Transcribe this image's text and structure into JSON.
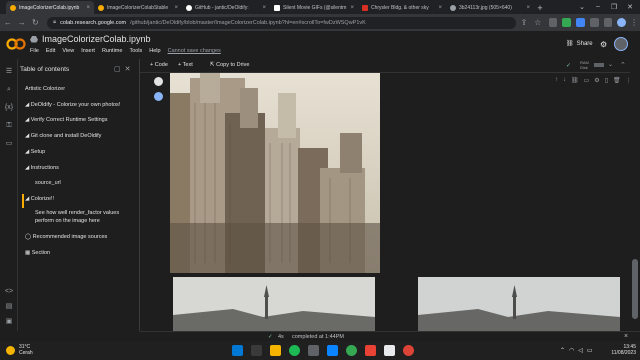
{
  "browser": {
    "tabs": [
      {
        "label": "ImageColorizerColab.ipynb",
        "favicon": "colab-icon",
        "color": "#f9ab00",
        "active": true
      },
      {
        "label": "ImageColorizerColabStable",
        "favicon": "colab-icon",
        "color": "#f9ab00",
        "active": false
      },
      {
        "label": "GitHub - jantic/DeOldify:",
        "favicon": "github-icon",
        "color": "#ffffff",
        "active": false
      },
      {
        "label": "Silent Movie GIFs (@silentm",
        "favicon": "x-icon",
        "color": "#ffffff",
        "active": false
      },
      {
        "label": "Chrysler Bldg. & other sky",
        "favicon": "page-icon",
        "color": "#d93025",
        "active": false
      },
      {
        "label": "3b24113r.jpg (505×640)",
        "favicon": "globe-icon",
        "color": "#9aa0a6",
        "active": false
      }
    ],
    "tab_close": "×",
    "new_tab": "+",
    "url_host": "colab.research.google.com",
    "url_path": "/github/jantic/DeOldify/blob/master/ImageColorizerColab.ipynb?hl=en#scrollTo=fwDzWSQwP1vK",
    "window_controls": [
      "⌄",
      "–",
      "❐",
      "✕"
    ]
  },
  "colab": {
    "logo": "CO",
    "notebook_title": "ImageColorizerColab.ipynb",
    "menus": [
      "File",
      "Edit",
      "View",
      "Insert",
      "Runtime",
      "Tools",
      "Help"
    ],
    "unsaved": "Cannot save changes",
    "share": "Share"
  },
  "toc": {
    "title": "Table of contents",
    "items": [
      {
        "label": "Artistic Colorizer",
        "level": 0
      },
      {
        "label": "◢ DeOldify - Colorize your own photos!",
        "level": 1
      },
      {
        "label": "◢ Verify Correct Runtime Settings",
        "level": 1
      },
      {
        "label": "◢ Git clone and install DeOldify",
        "level": 1
      },
      {
        "label": "◢ Setup",
        "level": 1
      },
      {
        "label": "◢ Instructions",
        "level": 1
      },
      {
        "label": "source_url",
        "level": 2
      },
      {
        "label": "◢ Colorize!!",
        "level": 1
      },
      {
        "label": "See how well render_factor values",
        "level": 2
      },
      {
        "label": "perform on the image here",
        "level": 2
      },
      {
        "label": "◯ Recommended image sources",
        "level": 1
      },
      {
        "label": "▦ Section",
        "level": 1
      }
    ]
  },
  "toolbar": {
    "code": "+ Code",
    "text": "+ Text",
    "copy_drive": "Copy to Drive",
    "ram": "RAM",
    "disk": "Disk"
  },
  "status": {
    "check": "✓",
    "duration": "4s",
    "text": "completed at 1:44PM",
    "close": "×"
  },
  "taskbar": {
    "temp": "31°C",
    "weather": "Cerah",
    "time": "13:45",
    "date": "11/08/2023"
  }
}
